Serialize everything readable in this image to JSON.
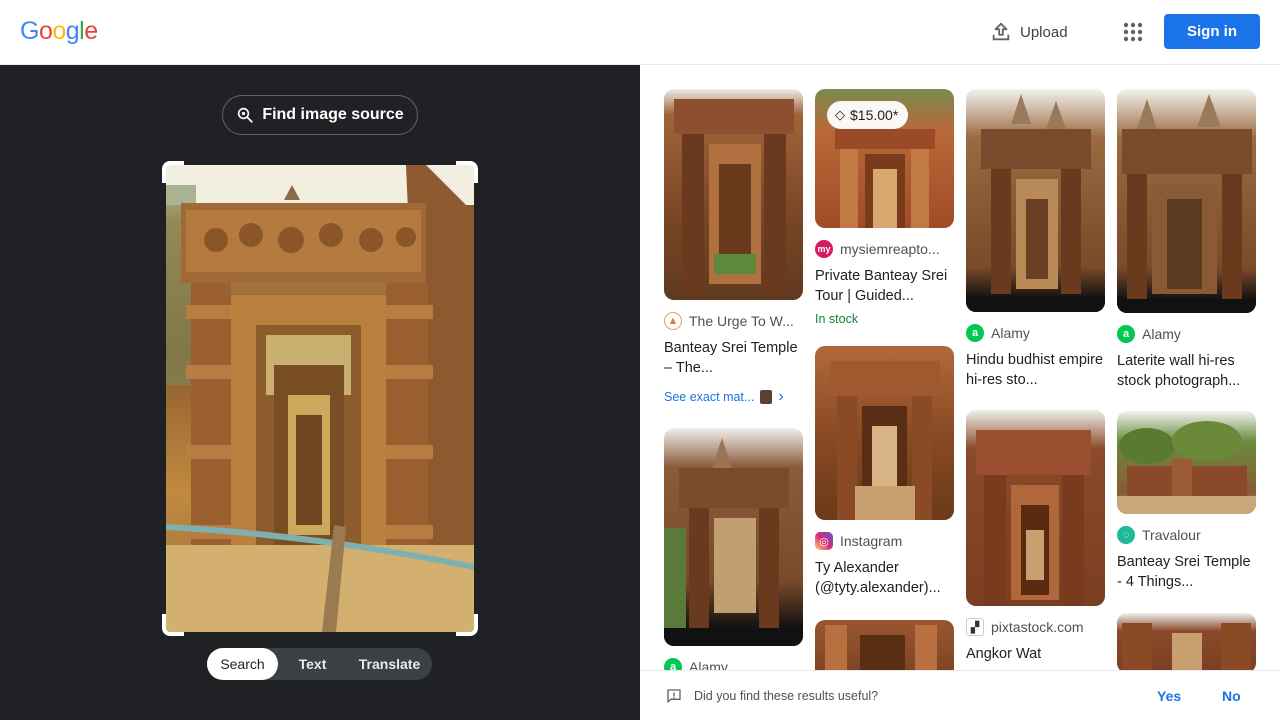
{
  "header": {
    "logo_letters": [
      {
        "ch": "G",
        "color": "#4285F4"
      },
      {
        "ch": "o",
        "color": "#EA4335"
      },
      {
        "ch": "o",
        "color": "#FBBC05"
      },
      {
        "ch": "g",
        "color": "#4285F4"
      },
      {
        "ch": "l",
        "color": "#34A853"
      },
      {
        "ch": "e",
        "color": "#EA4335"
      }
    ],
    "upload_label": "Upload",
    "upload_icon": "upload-icon",
    "apps_icon": "apps-grid-icon",
    "signin_label": "Sign in"
  },
  "left": {
    "find_source_label": "Find image source",
    "lens_icon": "lens-search-icon",
    "modes": [
      "Search",
      "Text",
      "Translate"
    ],
    "active_mode": "Search"
  },
  "results": [
    {
      "source": "The Urge To W...",
      "title": "Banteay Srei Temple – The...",
      "favicon": "urge-favicon",
      "exact": "See exact mat..."
    },
    {
      "price": "$15.00*",
      "source": "mysiemreapto...",
      "title": "Private Banteay Srei Tour | Guided...",
      "status": "In stock",
      "favicon": "mysiemreap-favicon"
    },
    {
      "source": "Alamy",
      "title": "Hindu budhist empire hi-res sto...",
      "favicon": "alamy-favicon"
    },
    {
      "source": "Alamy",
      "title": "Laterite wall hi-res stock photograph...",
      "favicon": "alamy-favicon"
    },
    {
      "source": "Alamy",
      "title": "",
      "favicon": "alamy-favicon"
    },
    {
      "source": "Instagram",
      "title": "Ty Alexander (@tyty.alexander)...",
      "favicon": "instagram-favicon"
    },
    {
      "source": "pixtastock.com",
      "title": "Angkor Wat",
      "favicon": "pixtastock-favicon"
    },
    {
      "source": "Travalour",
      "title": "Banteay Srei Temple - 4 Things...",
      "favicon": "travalour-favicon"
    }
  ],
  "feedback": {
    "question": "Did you find these results useful?",
    "yes": "Yes",
    "no": "No"
  },
  "colors": {
    "accent": "#1a73e8",
    "dark_pane": "#202124",
    "in_stock": "#188038"
  }
}
